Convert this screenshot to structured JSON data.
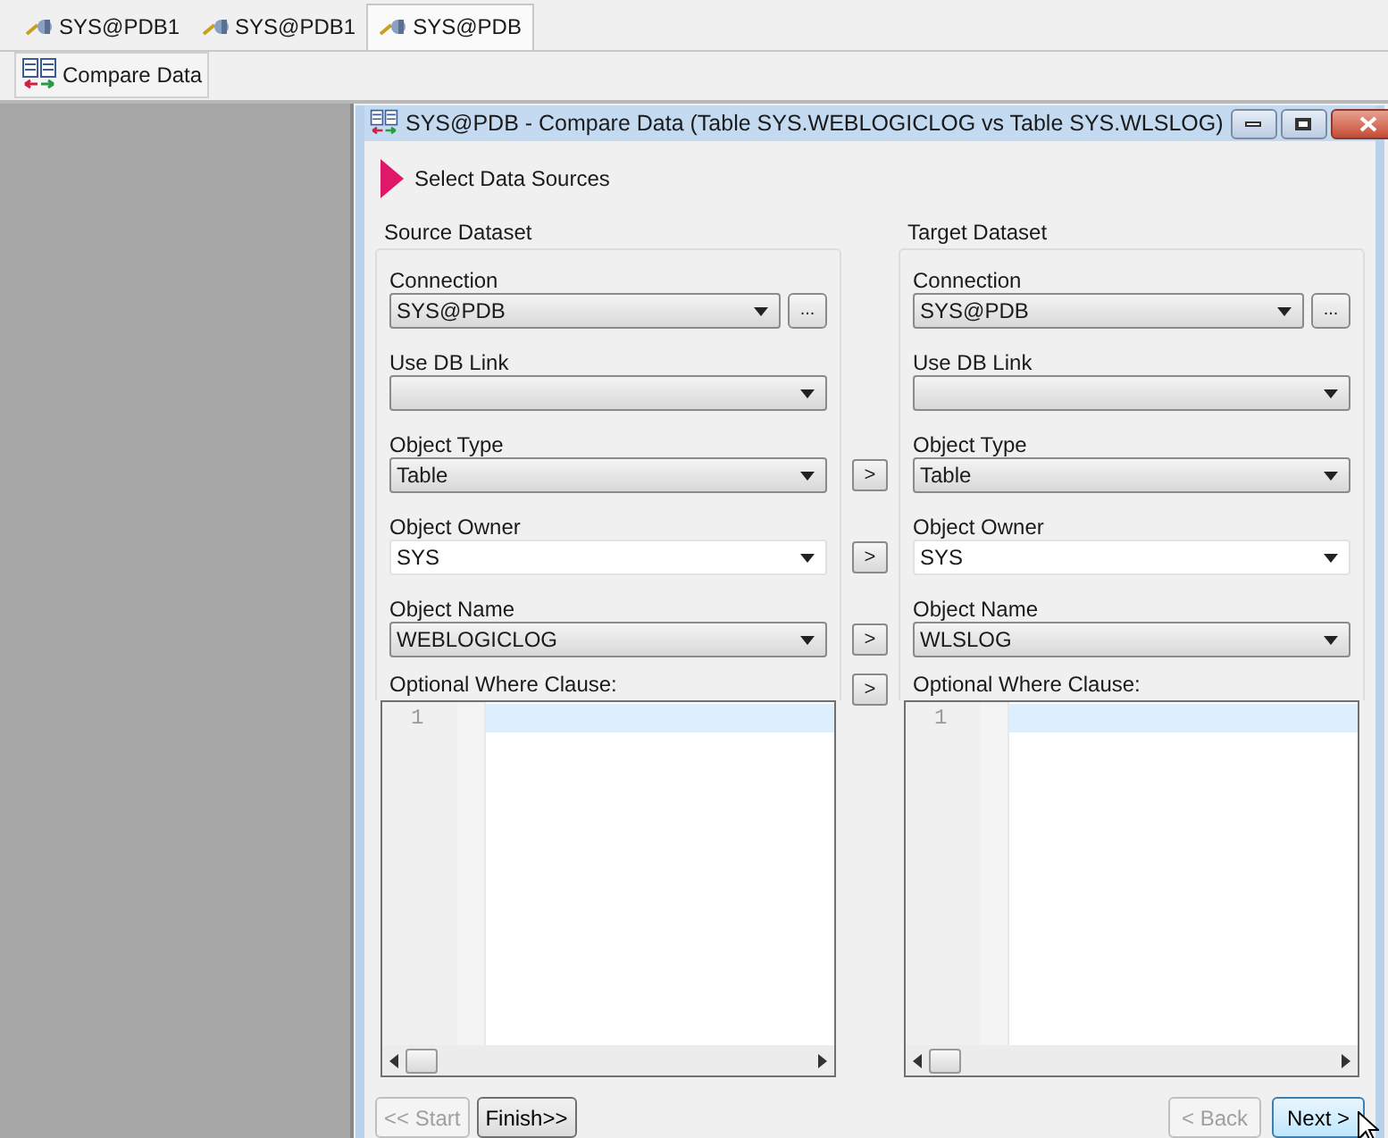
{
  "tabs": [
    {
      "label": "SYS@PDB1",
      "selected": false
    },
    {
      "label": "SYS@PDB1",
      "selected": false
    },
    {
      "label": "SYS@PDB",
      "selected": true
    }
  ],
  "toolbar": {
    "button": "Compare Data"
  },
  "dialog": {
    "title": "SYS@PDB - Compare Data (Table SYS.WEBLOGICLOG vs Table SYS.WLSLOG)",
    "step": "Select Data Sources",
    "panels": [
      {
        "title": "Source Dataset",
        "fields": [
          {
            "label": "Connection",
            "value": "SYS@PDB",
            "kind": "select",
            "browse": "..."
          },
          {
            "label": "Use DB Link",
            "kind": "select"
          },
          {
            "label": "Object Type",
            "value": "Table",
            "kind": "select",
            "copy": ">"
          },
          {
            "label": "Object Owner",
            "value": "SYS",
            "kind": "editable",
            "copy": ">"
          },
          {
            "label": "Object Name",
            "value": "WEBLOGICLOG",
            "kind": "select",
            "copy": ">"
          }
        ],
        "where_label": "Optional Where Clause:",
        "where_copy": ">",
        "line_number": "1"
      },
      {
        "title": "Target Dataset",
        "fields": [
          {
            "label": "Connection",
            "value": "SYS@PDB",
            "kind": "select",
            "browse": "..."
          },
          {
            "label": "Use DB Link",
            "kind": "select"
          },
          {
            "label": "Object Type",
            "value": "Table",
            "kind": "select"
          },
          {
            "label": "Object Owner",
            "value": "SYS",
            "kind": "editable"
          },
          {
            "label": "Object Name",
            "value": "WLSLOG",
            "kind": "select"
          }
        ],
        "where_label": "Optional Where Clause:",
        "line_number": "1"
      }
    ],
    "left_buttons": [
      {
        "label": "<< Start",
        "disabled": true,
        "focused": false
      },
      {
        "label": "Finish>>",
        "disabled": false,
        "focused": false
      }
    ],
    "right_buttons": [
      {
        "label": "< Back",
        "disabled": true,
        "focused": false
      },
      {
        "label": "Next >",
        "disabled": false,
        "focused": true
      }
    ]
  }
}
